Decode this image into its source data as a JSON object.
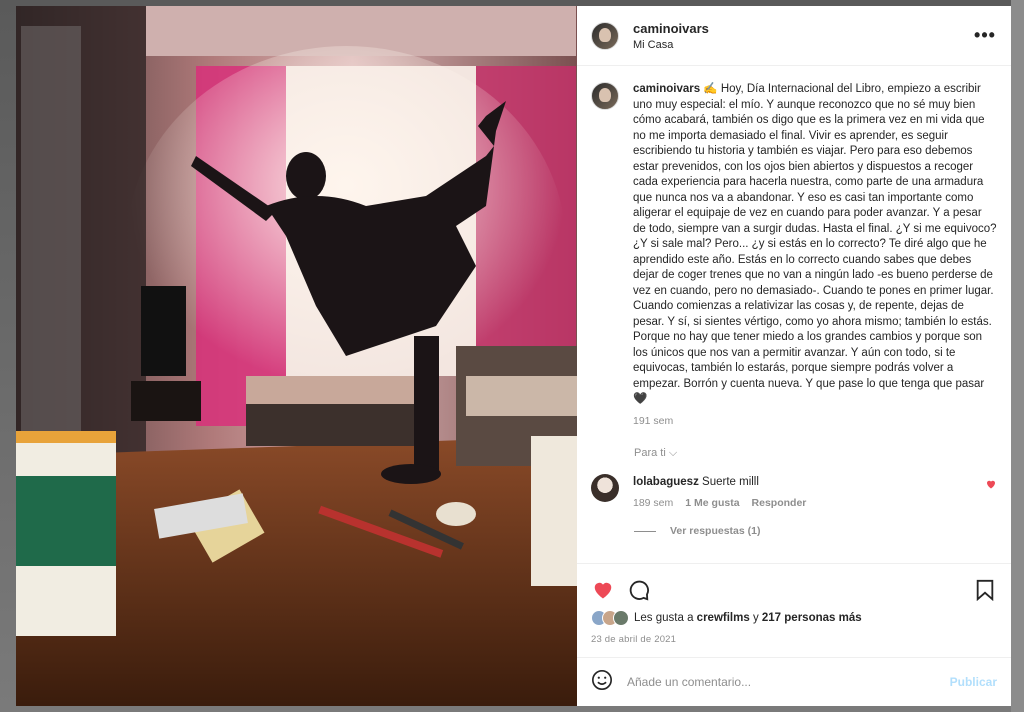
{
  "post": {
    "username": "caminoivars",
    "location": "Mi Casa",
    "more_label": "•••",
    "caption_text": "✍️ Hoy, Día Internacional del Libro, empiezo a escribir uno muy especial: el mío. Y aunque reconozco que no sé muy bien cómo acabará, también os digo que es la primera vez en mi vida que no me importa demasiado el final. Vivir es aprender, es seguir escribiendo tu historia y también es viajar. Pero para eso debemos estar prevenidos, con los ojos bien abiertos y dispuestos a recoger cada experiencia para hacerla nuestra, como parte de una armadura que nunca nos va a abandonar. Y eso es casi tan importante como aligerar el equipaje de vez en cuando para poder avanzar. Y a pesar de todo, siempre van a surgir dudas. Hasta el final. ¿Y si me equivoco? ¿Y si sale mal? Pero... ¿y si estás en lo correcto? Te diré algo que he aprendido este año. Estás en lo correcto cuando sabes que debes dejar de coger trenes que no van a ningún lado -es bueno perderse de vez en cuando, pero no demasiado-. Cuando te pones en primer lugar. Cuando comienzas a relativizar las cosas y, de repente, dejas de pesar. Y sí, si sientes vértigo, como yo ahora mismo; también lo estás. Porque no hay que tener miedo a los grandes cambios y porque son los únicos que nos van a permitir avanzar. Y aún con todo, si te equivocas, también lo estarás, porque siempre podrás volver a empezar. Borrón y cuenta nueva. Y que pase lo que tenga que pasar 🖤",
    "caption_time": "191 sem",
    "for_you": "Para ti ⌵"
  },
  "comment": {
    "username": "lolabaguesz",
    "text": "Suerte milll",
    "time": "189 sem",
    "likes": "1 Me gusta",
    "reply": "Responder",
    "view_replies": "Ver respuestas (1)"
  },
  "likes": {
    "prefix": "Les gusta a",
    "user": "crewfilms",
    "middle": "y",
    "others": "217 personas más"
  },
  "date": "23 de abril de 2021",
  "add_comment": {
    "placeholder": "Añade un comentario...",
    "publish": "Publicar"
  },
  "colors": {
    "like_red": "#ed4956",
    "publish_blue": "#b2dffc"
  },
  "icons": [
    "more-icon",
    "heart-icon",
    "comment-icon",
    "bookmark-icon",
    "emoji-icon",
    "small-heart-icon"
  ]
}
